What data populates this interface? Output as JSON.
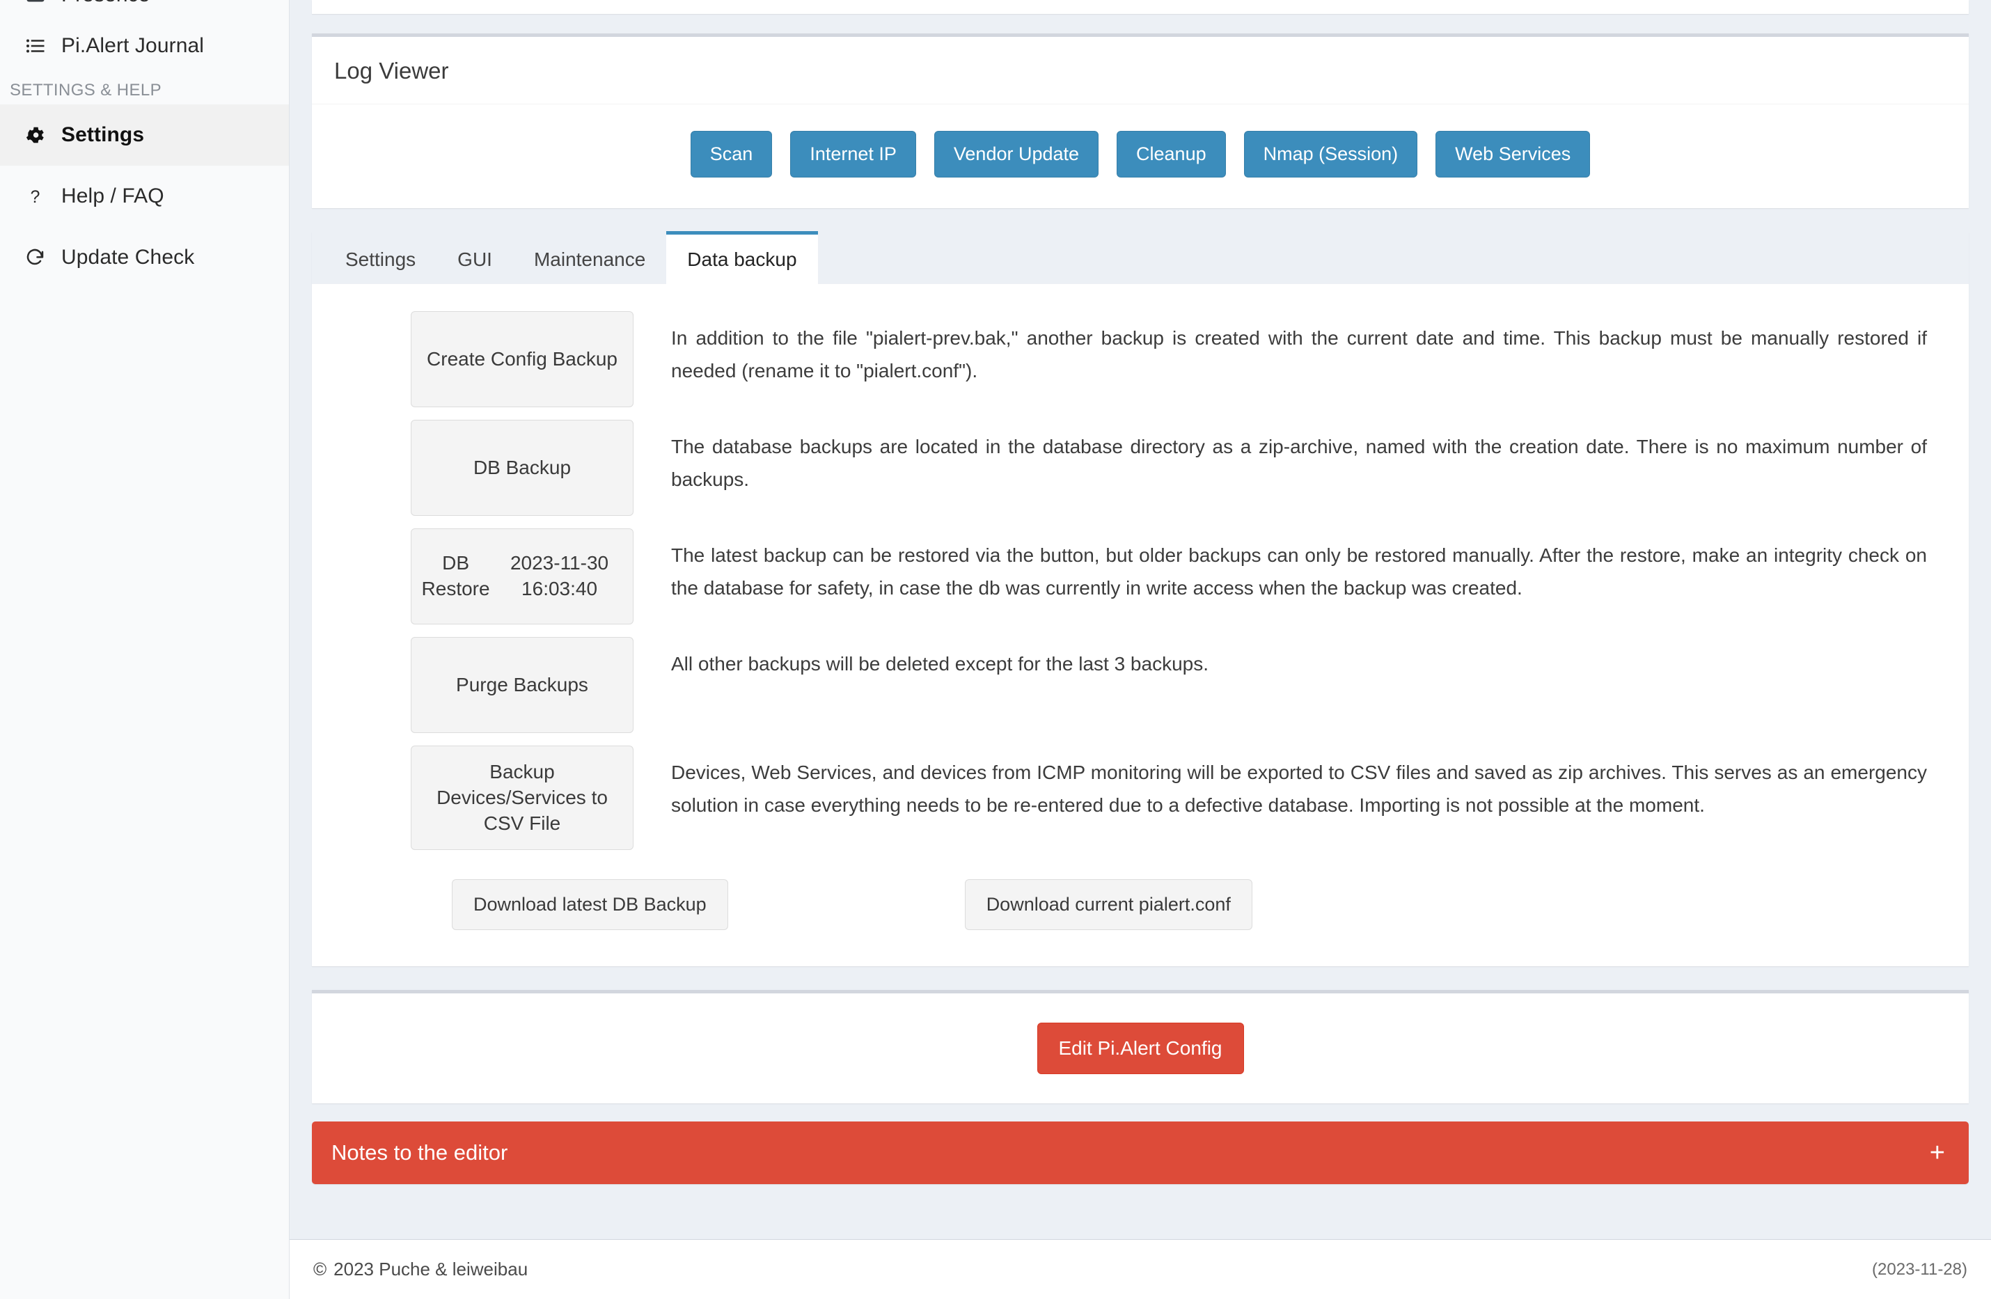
{
  "sidebar": {
    "clipped_item": {
      "label": "Presence",
      "icon": "presence-icon"
    },
    "items": [
      {
        "label": "Pi.Alert Journal",
        "icon": "list-icon",
        "active": false
      }
    ],
    "section_header": "SETTINGS & HELP",
    "settings_items": [
      {
        "label": "Settings",
        "icon": "gear-icon",
        "active": true
      },
      {
        "label": "Help / FAQ",
        "icon": "question-icon",
        "active": false
      },
      {
        "label": "Update Check",
        "icon": "refresh-icon",
        "active": false
      }
    ]
  },
  "log_viewer": {
    "title": "Log Viewer",
    "buttons": [
      "Scan",
      "Internet IP",
      "Vendor Update",
      "Cleanup",
      "Nmap (Session)",
      "Web Services"
    ]
  },
  "tabs": [
    {
      "label": "Settings",
      "active": false
    },
    {
      "label": "GUI",
      "active": false
    },
    {
      "label": "Maintenance",
      "active": false
    },
    {
      "label": "Data backup",
      "active": true
    }
  ],
  "data_backup": {
    "rows": [
      {
        "button": "Create Config Backup",
        "description": "In addition to the file \"pialert-prev.bak,\" another backup is created with the current date and time. This backup must be manually restored if needed (rename it to \"pialert.conf\")."
      },
      {
        "button": "DB Backup",
        "description": "The database backups are located in the database directory as a zip-archive, named with the creation date. There is no maximum number of backups."
      },
      {
        "button": "DB Restore\n2023-11-30 16:03:40",
        "button_line1": "DB Restore",
        "button_line2": "2023-11-30 16:03:40",
        "description": "The latest backup can be restored via the button, but older backups can only be restored manually. After the restore, make an integrity check on the database for safety, in case the db was currently in write access when the backup was created."
      },
      {
        "button": "Purge Backups",
        "description": "All other backups will be deleted except for the last 3 backups."
      },
      {
        "button": "Backup Devices/Services to CSV File",
        "description": "Devices, Web Services, and devices from ICMP monitoring will be exported to CSV files and saved as zip archives. This serves as an emergency solution in case everything needs to be re-entered due to a defective database. Importing is not possible at the moment."
      }
    ],
    "download_db_backup": "Download latest DB Backup",
    "download_conf": "Download current pialert.conf"
  },
  "edit_config": {
    "button": "Edit Pi.Alert Config"
  },
  "notes": {
    "title": "Notes to the editor",
    "toggle_icon": "plus-icon"
  },
  "footer": {
    "copyright_glyph": "©",
    "copyright": "2023 Puche & leiweibau",
    "version_date": "(2023-11-28)"
  },
  "colors": {
    "primary_blue": "#3c8dbc",
    "danger_red": "#dd4b39",
    "content_bg": "#ecf0f5",
    "sidebar_bg": "#f9fafb",
    "button_default": "#f4f4f4"
  }
}
